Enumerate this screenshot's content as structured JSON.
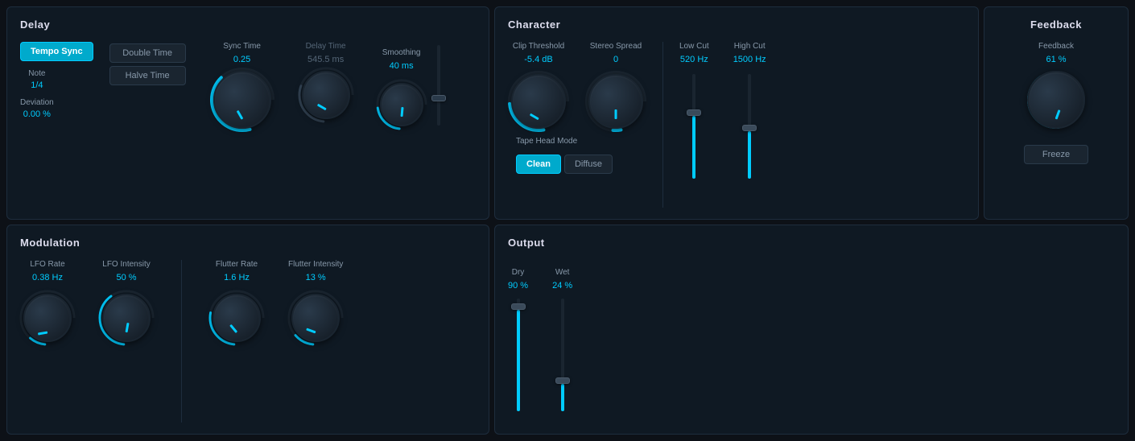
{
  "delay": {
    "title": "Delay",
    "tempo_sync_label": "Tempo Sync",
    "tempo_sync_active": true,
    "note_label": "Note",
    "note_value": "1/4",
    "deviation_label": "Deviation",
    "deviation_value": "0.00 %",
    "double_time_label": "Double Time",
    "halve_time_label": "Halve Time",
    "sync_time_label": "Sync Time",
    "sync_time_value": "0.25",
    "delay_time_label": "Delay Time",
    "delay_time_value": "545.5 ms",
    "smoothing_label": "Smoothing",
    "smoothing_value": "40 ms",
    "sync_knob_rotation": -30,
    "delay_knob_rotation": -60,
    "smoothing_knob_rotation": 0,
    "smoothing_slider_pct": 30
  },
  "character": {
    "title": "Character",
    "clip_threshold_label": "Clip Threshold",
    "clip_threshold_value": "-5.4 dB",
    "clip_knob_rotation": -60,
    "stereo_spread_label": "Stereo Spread",
    "stereo_spread_value": "0",
    "stereo_knob_rotation": 0,
    "low_cut_label": "Low Cut",
    "low_cut_value": "520 Hz",
    "high_cut_label": "High Cut",
    "high_cut_value": "1500 Hz",
    "tape_head_label": "Tape Head Mode",
    "clean_label": "Clean",
    "diffuse_label": "Diffuse",
    "clean_active": true,
    "low_cut_slider_pct": 60,
    "high_cut_slider_pct": 45
  },
  "feedback": {
    "title": "Feedback",
    "feedback_label": "Feedback",
    "feedback_value": "61 %",
    "feedback_knob_rotation": 20,
    "freeze_label": "Freeze"
  },
  "modulation": {
    "title": "Modulation",
    "lfo_rate_label": "LFO Rate",
    "lfo_rate_value": "0.38 Hz",
    "lfo_rate_rotation": -100,
    "lfo_intensity_label": "LFO Intensity",
    "lfo_intensity_value": "50 %",
    "lfo_intensity_rotation": 10,
    "flutter_rate_label": "Flutter Rate",
    "flutter_rate_value": "1.6 Hz",
    "flutter_rate_rotation": -40,
    "flutter_intensity_label": "Flutter Intensity",
    "flutter_intensity_value": "13 %",
    "flutter_intensity_rotation": -70
  },
  "output": {
    "title": "Output",
    "dry_label": "Dry",
    "dry_value": "90 %",
    "dry_slider_pct": 90,
    "wet_label": "Wet",
    "wet_value": "24 %",
    "wet_slider_pct": 24
  }
}
